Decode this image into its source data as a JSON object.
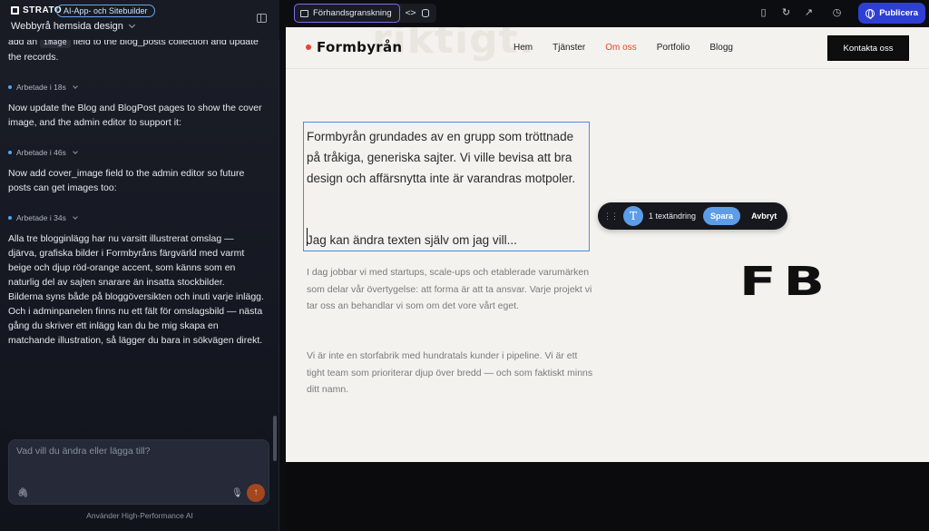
{
  "left_panel": {
    "brand": "STRATO",
    "badge": "AI-App- och Sitebuilder",
    "project_name": "Webbyrå hemsida design",
    "messages": {
      "m0_pre": "add an",
      "m0_code": "image",
      "m0_post": "field to the blog_posts collection and update the records.",
      "s1": "Arbetade i 18s",
      "m1": "Now update the Blog and BlogPost pages to show the cover image, and the admin editor to support it:",
      "s2": "Arbetade i 46s",
      "m2": "Now add cover_image field to the admin editor so future posts can get images too:",
      "s3": "Arbetade i 34s",
      "m3": "Alla tre blogginlägg har nu varsitt illustrerat omslag — djärva, grafiska bilder i Formbyråns färgvärld med varmt beige och djup röd-orange accent, som känns som en naturlig del av sajten snarare än insatta stockbilder.",
      "m4": "Bilderna syns både på bloggöversikten och inuti varje inlägg. Och i adminpanelen finns nu ett fält för omslagsbild — nästa gång du skriver ett inlägg kan du be mig skapa en matchande illustration, så lägger du bara in sökvägen direkt."
    },
    "input_placeholder": "Vad vill du ändra eller lägga till?",
    "input_value": "",
    "footer": "Använder High-Performance AI"
  },
  "toolbar": {
    "preview_tab": "Förhandsgranskning",
    "code_icon": "<>",
    "publish": "Publicera"
  },
  "site": {
    "ghost_text": "riktigt.",
    "brand": "Formbyrån",
    "nav": [
      "Hem",
      "Tjänster",
      "Om oss",
      "Portfolio",
      "Blogg"
    ],
    "active_nav": "Om oss",
    "cta": "Kontakta oss",
    "para1": "Formbyrån grundades av en grupp som tröttnade på tråkiga, generiska sajter. Vi ville bevisa att bra design och affärsnytta inte är varandras motpoler.",
    "para2": "Jag kan ändra texten själv om jag vill...",
    "body1": "I dag jobbar vi med startups, scale-ups och etablerade varumärken som delar vår övertygelse: att forma är att ta ansvar. Varje projekt vi tar oss an behandlar vi som om det vore vårt eget.",
    "body2": "Vi är inte en storfabrik med hundratals kunder i pipeline. Vi är ett tight team som prioriterar djup över bredd — och som faktiskt minns ditt namn.",
    "monogram": "FB",
    "edit_toolbar": {
      "icon_letter": "T",
      "count": "1 textändring",
      "save": "Spara",
      "cancel": "Avbryt"
    }
  },
  "colors": {
    "accent_red": "#e8432c",
    "publish_blue": "#2e3fd6",
    "selection_blue": "#4d8be6",
    "chip_blue": "#5d9de8",
    "send_orange": "#a4471f"
  },
  "icons": [
    "panel-toggle-icon",
    "browser-icon",
    "code-icon",
    "database-icon",
    "mobile-icon",
    "refresh-icon",
    "external-link-icon",
    "history-icon",
    "globe-icon",
    "paperclip-icon",
    "microphone-icon",
    "arrow-up-icon",
    "grip-icon",
    "text-icon"
  ]
}
